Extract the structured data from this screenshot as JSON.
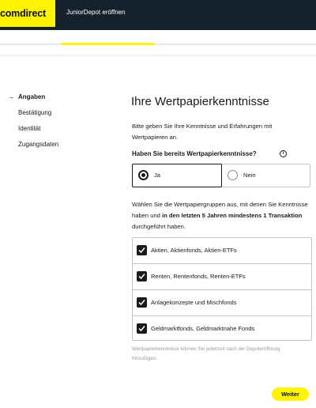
{
  "header": {
    "logo": "comdirect",
    "title": "JuniorDepot eröffnen"
  },
  "progress": {
    "fraction": 0.29
  },
  "sidebar": {
    "items": [
      {
        "label": "Angaben",
        "active": true
      },
      {
        "label": "Bestätigung",
        "active": false
      },
      {
        "label": "Identität",
        "active": false
      },
      {
        "label": "Zugangsdaten",
        "active": false
      }
    ]
  },
  "main": {
    "title": "Ihre Wertpapierkenntnisse",
    "intro": "Bitte geben Sie Ihre Kenntnisse und Erfahrungen mit Wertpapieren an.",
    "question": "Haben Sie bereits Wertpapierkenntnisse?",
    "radio": {
      "options": [
        {
          "label": "Ja",
          "selected": true
        },
        {
          "label": "Nein",
          "selected": false
        }
      ]
    },
    "description": {
      "part1": "Wählen Sie die Wertpapiergruppen aus, mit denen Sie Kenntnisse haben und ",
      "bold": "in den letzten 5 Jahren mindestens 1 Transaktion",
      "part2": " durchgeführt haben."
    },
    "checkboxes": [
      {
        "label": "Aktien, Aktienfonds, Aktien-ETFs",
        "checked": true
      },
      {
        "label": "Renten, Rentenfonds, Renten-ETFs",
        "checked": true
      },
      {
        "label": "Anlagekonzepte und Mischfonds",
        "checked": true
      },
      {
        "label": "Geldmarktfonds, Geldmarktnahe Fonds",
        "checked": true
      }
    ],
    "footnote": "Wertpapierkenntnisse können Sie jederzeit nach der Depoteröffnung hinzufügen.",
    "next_label": "Weiter"
  },
  "colors": {
    "brand_yellow": "#fff500",
    "topbar": "#14202b",
    "text": "#1a1a1a",
    "border": "#c4c4c4"
  },
  "icons": {
    "nav_active": "arrow-right-icon",
    "info": "info-icon",
    "check": "checkmark-icon"
  }
}
